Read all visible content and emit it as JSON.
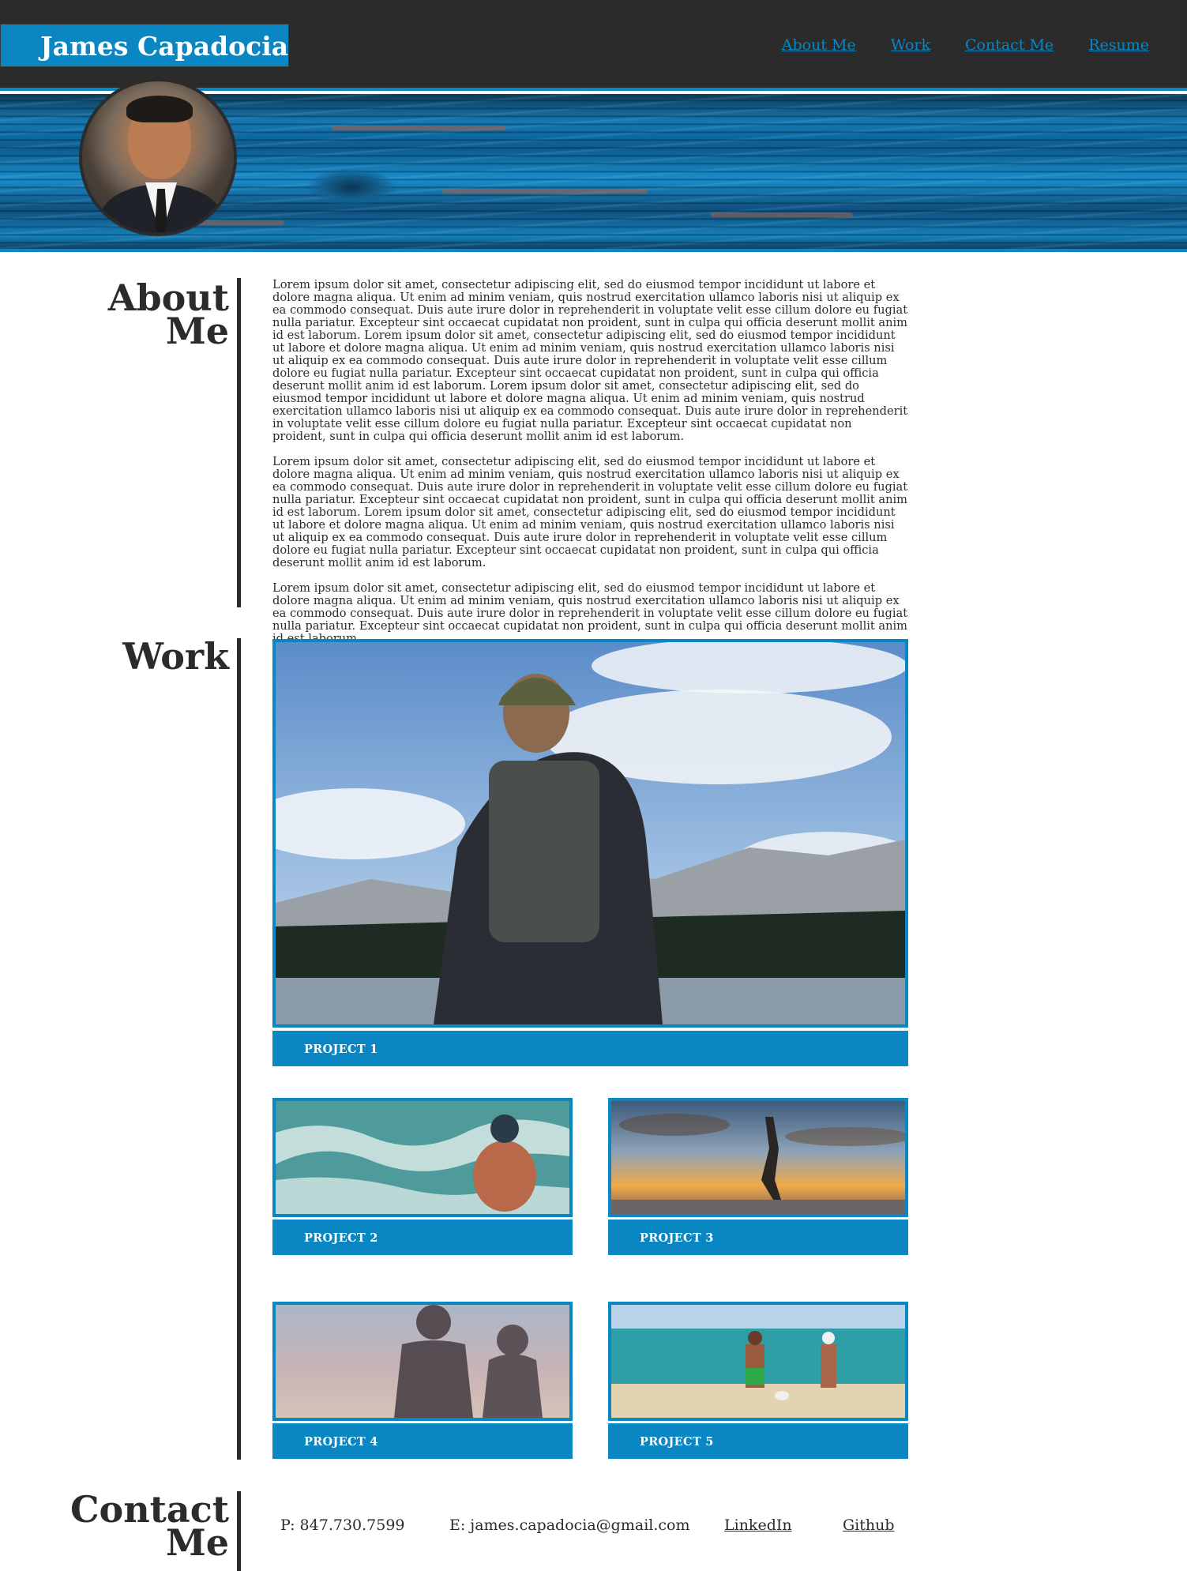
{
  "header": {
    "brand": "James Capadocia",
    "nav": [
      "About Me",
      "Work",
      "Contact Me",
      "Resume"
    ],
    "accent_color": "#0a86c2",
    "background_color": "#2b2b2b"
  },
  "hero": {
    "avatar": "profile-photo"
  },
  "about": {
    "title_line1": "About",
    "title_line2": "Me",
    "paragraphs": [
      "Lorem ipsum dolor sit amet, consectetur adipiscing elit, sed do eiusmod tempor incididunt ut labore et dolore magna aliqua. Ut enim ad minim veniam, quis nostrud exercitation ullamco laboris nisi ut aliquip ex ea commodo consequat. Duis aute irure dolor in reprehenderit in voluptate velit esse cillum dolore eu fugiat nulla pariatur. Excepteur sint occaecat cupidatat non proident, sunt in culpa qui officia deserunt mollit anim id est laborum. Lorem ipsum dolor sit amet, consectetur adipiscing elit, sed do eiusmod tempor incididunt ut labore et dolore magna aliqua. Ut enim ad minim veniam, quis nostrud exercitation ullamco laboris nisi ut aliquip ex ea commodo consequat. Duis aute irure dolor in reprehenderit in voluptate velit esse cillum dolore eu fugiat nulla pariatur. Excepteur sint occaecat cupidatat non proident, sunt in culpa qui officia deserunt mollit anim id est laborum. Lorem ipsum dolor sit amet, consectetur adipiscing elit, sed do eiusmod tempor incididunt ut labore et dolore magna aliqua. Ut enim ad minim veniam, quis nostrud exercitation ullamco laboris nisi ut aliquip ex ea commodo consequat. Duis aute irure dolor in reprehenderit in voluptate velit esse cillum dolore eu fugiat nulla pariatur. Excepteur sint occaecat cupidatat non proident, sunt in culpa qui officia deserunt mollit anim id est laborum.",
      "Lorem ipsum dolor sit amet, consectetur adipiscing elit, sed do eiusmod tempor incididunt ut labore et dolore magna aliqua. Ut enim ad minim veniam, quis nostrud exercitation ullamco laboris nisi ut aliquip ex ea commodo consequat. Duis aute irure dolor in reprehenderit in voluptate velit esse cillum dolore eu fugiat nulla pariatur. Excepteur sint occaecat cupidatat non proident, sunt in culpa qui officia deserunt mollit anim id est laborum. Lorem ipsum dolor sit amet, consectetur adipiscing elit, sed do eiusmod tempor incididunt ut labore et dolore magna aliqua. Ut enim ad minim veniam, quis nostrud exercitation ullamco laboris nisi ut aliquip ex ea commodo consequat. Duis aute irure dolor in reprehenderit in voluptate velit esse cillum dolore eu fugiat nulla pariatur. Excepteur sint occaecat cupidatat non proident, sunt in culpa qui officia deserunt mollit anim id est laborum.",
      "Lorem ipsum dolor sit amet, consectetur adipiscing elit, sed do eiusmod tempor incididunt ut labore et dolore magna aliqua. Ut enim ad minim veniam, quis nostrud exercitation ullamco laboris nisi ut aliquip ex ea commodo consequat. Duis aute irure dolor in reprehenderit in voluptate velit esse cillum dolore eu fugiat nulla pariatur. Excepteur sint occaecat cupidatat non proident, sunt in culpa qui officia deserunt mollit anim id est laborum."
    ]
  },
  "work": {
    "title": "Work",
    "projects": [
      {
        "label": "PROJECT 1",
        "image": "hiker-mountain-lake-photo"
      },
      {
        "label": "PROJECT 2",
        "image": "surfer-ocean-photo"
      },
      {
        "label": "PROJECT 3",
        "image": "handstand-sunset-photo"
      },
      {
        "label": "PROJECT 4",
        "image": "couple-silhouette-photo"
      },
      {
        "label": "PROJECT 5",
        "image": "beach-couple-dog-photo"
      }
    ]
  },
  "contact": {
    "title_line1": "Contact",
    "title_line2": "Me",
    "phone": "P: 847.730.7599",
    "email": "E: james.capadocia@gmail.com",
    "linkedin": "LinkedIn",
    "github": "Github"
  }
}
